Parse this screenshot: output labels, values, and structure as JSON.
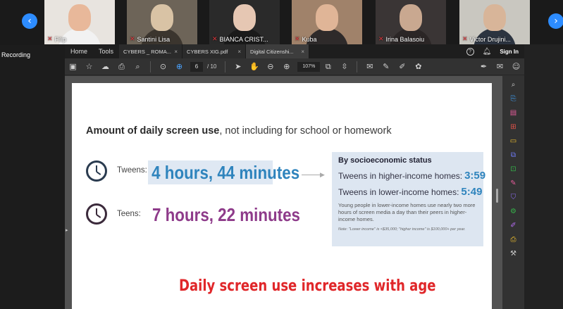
{
  "meeting": {
    "recording_label": "Recording",
    "participants": [
      {
        "name": "Filip",
        "bg": "#e8e4df",
        "face": "#e8b89a",
        "body": "#f2f2f2"
      },
      {
        "name": "Santini Lisa",
        "bg": "#6d6458",
        "face": "#d9c3a5",
        "body": "#3b352e"
      },
      {
        "name": "BIANCA CRIST...",
        "bg": "#2a2a2a",
        "face": "#e6c7b3",
        "body": "#1a1a1a"
      },
      {
        "name": "Kuba",
        "bg": "#a0826a",
        "face": "#e0b597",
        "body": "#2e2a2a"
      },
      {
        "name": "Irina Balasoiu",
        "bg": "#3a3535",
        "face": "#c9a890",
        "body": "#2b2626"
      },
      {
        "name": "Victor Drujini...",
        "bg": "#c9c7c0",
        "face": "#d8b599",
        "body": "#2c3440"
      }
    ]
  },
  "reader": {
    "menu": [
      "Home",
      "Tools"
    ],
    "tabs": [
      {
        "label": "CYBERS _ ROMA...",
        "active": false
      },
      {
        "label": "CYBERS XIG.pdf",
        "active": false
      },
      {
        "label": "Digital Citizenshi...",
        "active": true
      }
    ],
    "help_icon": "?",
    "sign_in": "Sign In",
    "page_current": "6",
    "page_total": "/ 10",
    "zoom": "107%"
  },
  "slide": {
    "heading_bold": "Amount of daily screen use",
    "heading_rest": ", not including for school or homework",
    "tweens_label": "Tweens:",
    "tweens_value": "4 hours, 44 minutes",
    "teens_label": "Teens:",
    "teens_value": "7 hours, 22 minutes",
    "panel_title": "By socioeconomic status",
    "higher_label": "Tweens in higher-income homes:",
    "higher_value": "3:59",
    "lower_label": "Tweens in lower-income homes:",
    "lower_value": "5:49",
    "panel_note": "Young people in lower-income homes use nearly two more hours of screen media a day than their peers in higher-income homes.",
    "panel_footnote": "Note: \"Lower income\" is <$35,000; \"higher income\" is $100,000+ per year.",
    "caption": "Daily screen use increases with age"
  },
  "colors": {
    "tweens_blue": "#2f84bd",
    "teens_purple": "#8e3b8a",
    "caption_red": "#e0272a",
    "accent_blue": "#2d8cff"
  }
}
